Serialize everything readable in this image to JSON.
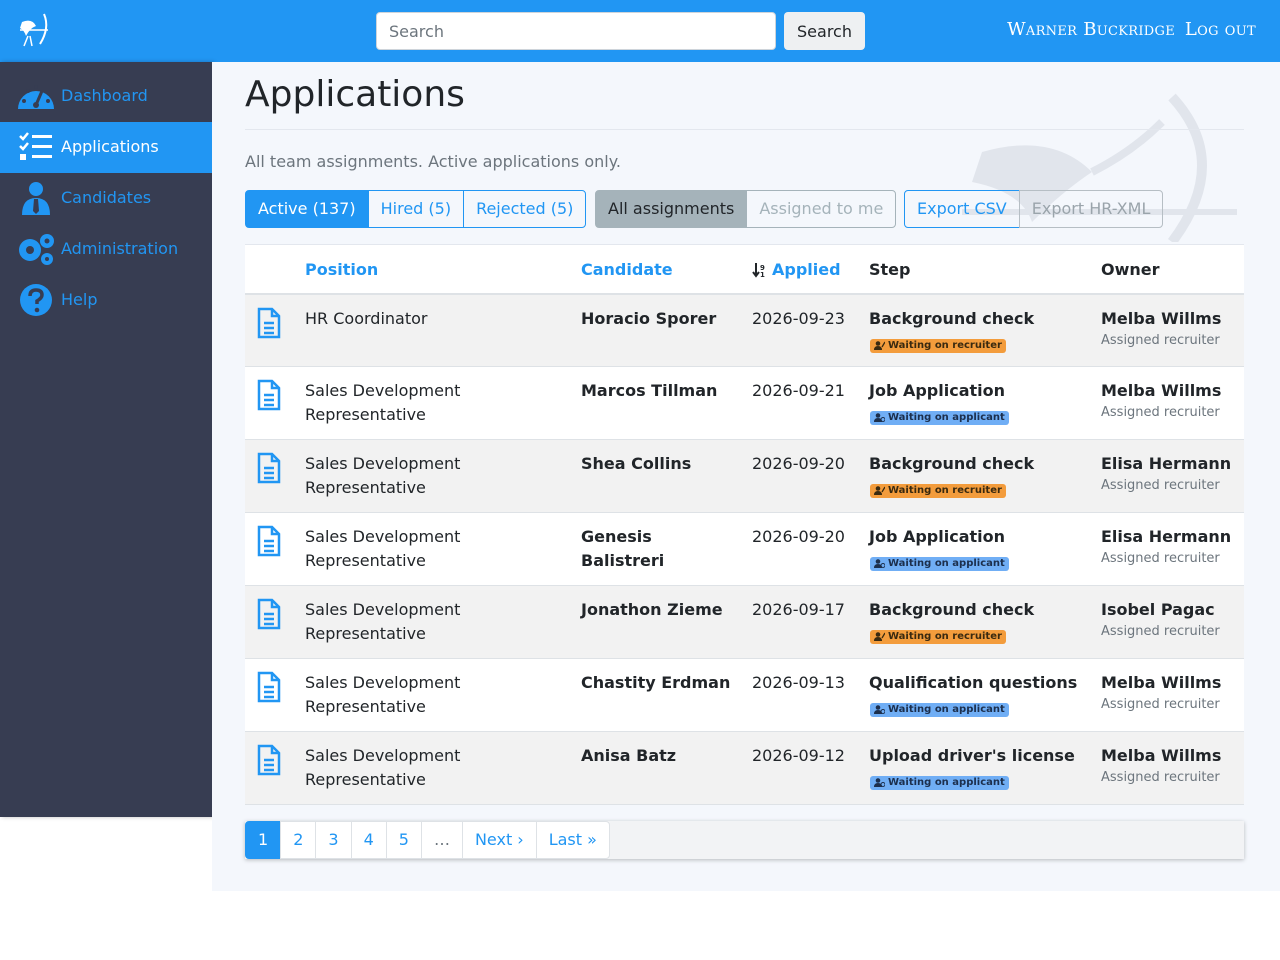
{
  "header": {
    "search_placeholder": "Search",
    "search_button": "Search",
    "user_name": "Warner Buckridge",
    "logout": "Log out"
  },
  "sidebar": {
    "items": [
      {
        "label": "Dashboard",
        "icon": "dashboard-icon",
        "active": false
      },
      {
        "label": "Applications",
        "icon": "list-check-icon",
        "active": true
      },
      {
        "label": "Candidates",
        "icon": "user-tie-icon",
        "active": false
      },
      {
        "label": "Administration",
        "icon": "gears-icon",
        "active": false
      },
      {
        "label": "Help",
        "icon": "question-circle-icon",
        "active": false
      }
    ]
  },
  "page": {
    "title": "Applications",
    "subtitle": "All team assignments. Active applications only."
  },
  "filters": {
    "status": [
      "Active (137)",
      "Hired (5)",
      "Rejected (5)"
    ],
    "assignment": [
      "All assignments",
      "Assigned to me"
    ],
    "export": [
      "Export CSV",
      "Export HR-XML"
    ]
  },
  "table": {
    "headers": {
      "position": "Position",
      "candidate": "Candidate",
      "applied": "Applied",
      "step": "Step",
      "owner": "Owner"
    },
    "rows": [
      {
        "position": "HR Coordinator",
        "candidate": "Horacio Sporer",
        "applied": "2026-09-23",
        "step": "Background check",
        "badge": "Waiting on recruiter",
        "badge_type": "recruiter",
        "owner": "Melba Willms",
        "owner_role": "Assigned recruiter"
      },
      {
        "position": "Sales Development Representative",
        "candidate": "Marcos Tillman",
        "applied": "2026-09-21",
        "step": "Job Application",
        "badge": "Waiting on applicant",
        "badge_type": "applicant",
        "owner": "Melba Willms",
        "owner_role": "Assigned recruiter"
      },
      {
        "position": "Sales Development Representative",
        "candidate": "Shea Collins",
        "applied": "2026-09-20",
        "step": "Background check",
        "badge": "Waiting on recruiter",
        "badge_type": "recruiter",
        "owner": "Elisa Hermann",
        "owner_role": "Assigned recruiter"
      },
      {
        "position": "Sales Development Representative",
        "candidate": "Genesis Balistreri",
        "applied": "2026-09-20",
        "step": "Job Application",
        "badge": "Waiting on applicant",
        "badge_type": "applicant",
        "owner": "Elisa Hermann",
        "owner_role": "Assigned recruiter"
      },
      {
        "position": "Sales Development Representative",
        "candidate": "Jonathon Zieme",
        "applied": "2026-09-17",
        "step": "Background check",
        "badge": "Waiting on recruiter",
        "badge_type": "recruiter",
        "owner": "Isobel Pagac",
        "owner_role": "Assigned recruiter"
      },
      {
        "position": "Sales Development Representative",
        "candidate": "Chastity Erdman",
        "applied": "2026-09-13",
        "step": "Qualification questions",
        "badge": "Waiting on applicant",
        "badge_type": "applicant",
        "owner": "Melba Willms",
        "owner_role": "Assigned recruiter"
      },
      {
        "position": "Sales Development Representative",
        "candidate": "Anisa Batz",
        "applied": "2026-09-12",
        "step": "Upload driver's license",
        "badge": "Waiting on applicant",
        "badge_type": "applicant",
        "owner": "Melba Willms",
        "owner_role": "Assigned recruiter"
      }
    ]
  },
  "pagination": {
    "pages": [
      "1",
      "2",
      "3",
      "4",
      "5",
      "…",
      "Next ›",
      "Last »"
    ],
    "current": "1"
  },
  "colors": {
    "primary": "#2196f3",
    "sidebar": "#373d52",
    "recruiter_badge": "#f39c3c",
    "applicant_badge": "#70aef5"
  }
}
